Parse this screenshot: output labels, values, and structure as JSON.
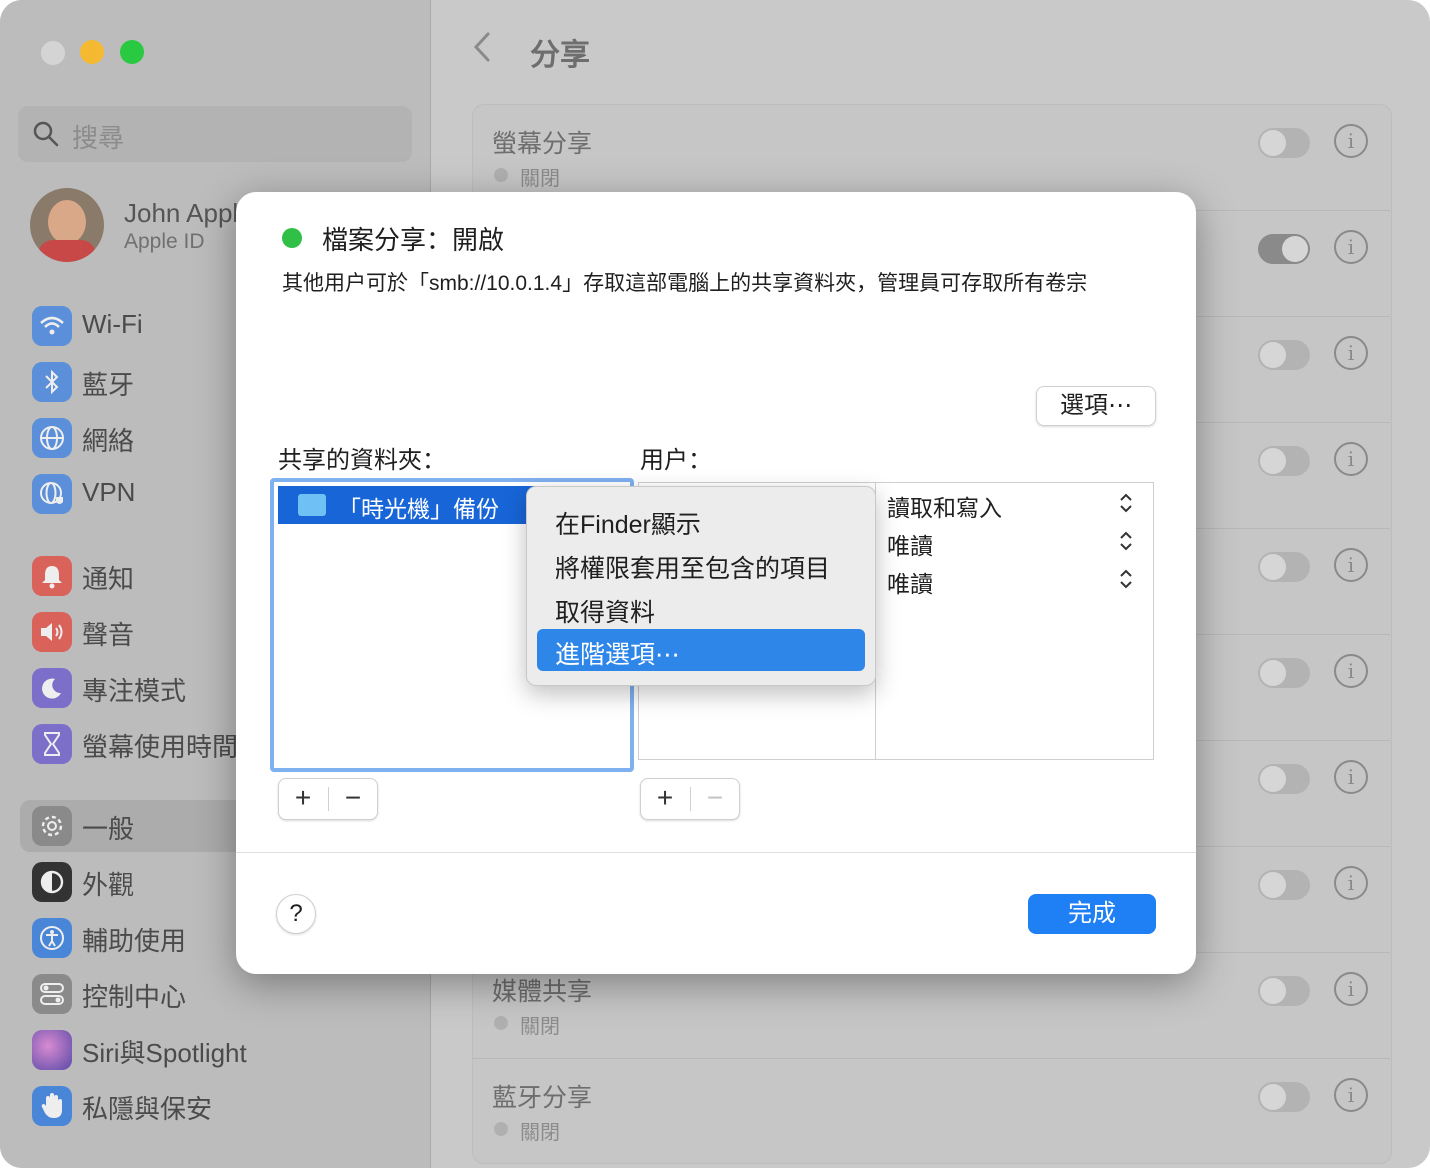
{
  "window": {
    "title": "分享",
    "traffic_colors": [
      "#d0d0d0",
      "#f5b931",
      "#29c941"
    ]
  },
  "sidebar": {
    "search_placeholder": "搜尋",
    "user": {
      "name": "John Appleseed",
      "subtitle": "Apple ID"
    },
    "items": [
      {
        "label": "Wi‑Fi",
        "icon": "wifi-icon",
        "color": "#5b8fd9"
      },
      {
        "label": "藍牙",
        "icon": "bluetooth-icon",
        "color": "#5b8fd9"
      },
      {
        "label": "網絡",
        "icon": "globe-icon",
        "color": "#5b8fd9"
      },
      {
        "label": "VPN",
        "icon": "vpn-globe-icon",
        "color": "#5b8fd9"
      },
      {
        "label": "通知",
        "icon": "bell-icon",
        "color": "#d9625b"
      },
      {
        "label": "聲音",
        "icon": "speaker-icon",
        "color": "#d9625b"
      },
      {
        "label": "專注模式",
        "icon": "moon-icon",
        "color": "#7b6fc9"
      },
      {
        "label": "螢幕使用時間",
        "icon": "hourglass-icon",
        "color": "#7b6fc9"
      },
      {
        "label": "一般",
        "icon": "gear-icon",
        "color": "#8a8a8a"
      },
      {
        "label": "外觀",
        "icon": "appearance-icon",
        "color": "#333333"
      },
      {
        "label": "輔助使用",
        "icon": "accessibility-icon",
        "color": "#4a86d8"
      },
      {
        "label": "控制中心",
        "icon": "switches-icon",
        "color": "#8a8a8a"
      },
      {
        "label": "Siri與Spotlight",
        "icon": "siri-icon",
        "color": "#7a5fc0"
      },
      {
        "label": "私隱與保安",
        "icon": "hand-icon",
        "color": "#4a86d8"
      }
    ]
  },
  "main": {
    "back_icon": "chevron-left-icon",
    "rows": [
      {
        "title": "螢幕分享",
        "status": "關閉",
        "toggle_on": false
      },
      {
        "title": "",
        "status": "",
        "toggle_on": true
      },
      {
        "title": "",
        "status": "",
        "toggle_on": false
      },
      {
        "title": "",
        "status": "",
        "toggle_on": false
      },
      {
        "title": "",
        "status": "",
        "toggle_on": false
      },
      {
        "title": "",
        "status": "",
        "toggle_on": false
      },
      {
        "title": "",
        "status": "",
        "toggle_on": false
      },
      {
        "title": "",
        "status": "",
        "toggle_on": false
      },
      {
        "title": "媒體共享",
        "status": "關閉",
        "toggle_on": false
      },
      {
        "title": "藍牙分享",
        "status": "關閉",
        "toggle_on": false
      }
    ]
  },
  "dialog": {
    "title": "檔案分享：開啟",
    "description": "其他用户可於「smb://10.0.1.4」存取這部電腦上的共享資料夾，管理員可存取所有卷宗",
    "options_button": "選項⋯",
    "shared_folders_label": "共享的資料夾：",
    "users_label": "用户：",
    "folders": [
      "「時光機」備份"
    ],
    "permissions": [
      "讀取和寫入",
      "唯讀",
      "唯讀"
    ],
    "add_symbol": "+",
    "remove_symbol": "−",
    "help_symbol": "?",
    "done_button": "完成"
  },
  "context_menu": {
    "items": [
      "在Finder顯示",
      "將權限套用至包含的項目",
      "取得資料",
      "進階選項⋯"
    ],
    "highlighted_index": 3
  }
}
